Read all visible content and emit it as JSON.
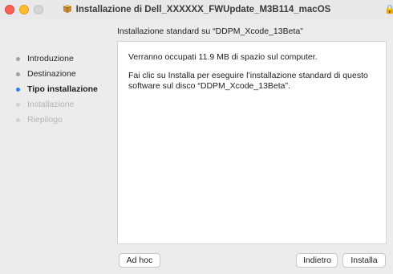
{
  "window": {
    "title": "Installazione di Dell_XXXXXX_FWUpdate_M3B114_macOS",
    "title_icon": "package-icon",
    "lock_icon": "lock-icon"
  },
  "subtitle": "Installazione standard su “DDPM_Xcode_13Beta”",
  "sidebar": {
    "steps": [
      {
        "label": "Introduzione",
        "state": "done"
      },
      {
        "label": "Destinazione",
        "state": "done"
      },
      {
        "label": "Tipo installazione",
        "state": "current"
      },
      {
        "label": "Installazione",
        "state": "future"
      },
      {
        "label": "Riepilogo",
        "state": "future"
      }
    ]
  },
  "content": {
    "space_text": "Verranno occupati 11.9 MB di spazio sul computer.",
    "install_text": "Fai clic su Installa per eseguire l’installazione standard di questo software sul disco “DDPM_Xcode_13Beta”."
  },
  "buttons": {
    "adhoc": "Ad hoc",
    "back": "Indietro",
    "install": "Installa"
  },
  "colors": {
    "current_step": "#2f7cf6",
    "close": "#fe5f57",
    "minimize": "#febc2e"
  }
}
